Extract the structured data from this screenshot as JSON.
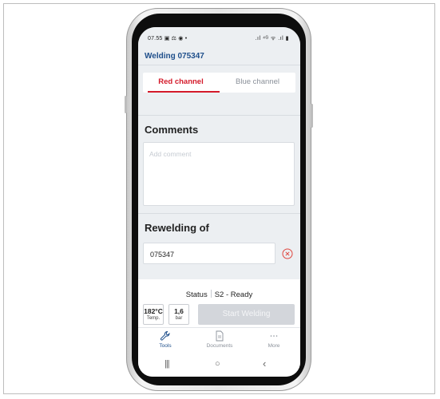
{
  "statusbar": {
    "time": "07.55",
    "left_icons": "▣ ⚖ ◉ •",
    "right_icons": ".ıl ⁴ᴳ ᯤ .ıl ▮"
  },
  "app": {
    "title": "Welding 075347"
  },
  "tabs": {
    "red": "Red channel",
    "blue": "Blue channel",
    "active": "red",
    "active_color": "#d41a2a"
  },
  "comments": {
    "title": "Comments",
    "placeholder": "Add comment",
    "value": ""
  },
  "rewelding": {
    "title": "Rewelding of",
    "value": "075347",
    "clear_icon": "clear-circle-icon"
  },
  "status": {
    "label": "Status",
    "value": "S2 - Ready"
  },
  "metrics": [
    {
      "value": "182°C",
      "label": "Temp."
    },
    {
      "value": "1,6",
      "label": "bar"
    }
  ],
  "actions": {
    "start_welding": "Start Welding"
  },
  "bottom_nav": [
    {
      "label": "Tools",
      "icon": "wrench-icon",
      "active": true
    },
    {
      "label": "Documents",
      "icon": "document-icon",
      "active": false
    },
    {
      "label": "More",
      "icon": "more-dots-icon",
      "active": false
    }
  ],
  "system_nav": {
    "recents": "|||",
    "home": "○",
    "back": "‹"
  },
  "colors": {
    "accent_blue": "#1f4f8b",
    "accent_red": "#d41a2a",
    "disabled_button": "#d3d6db"
  }
}
